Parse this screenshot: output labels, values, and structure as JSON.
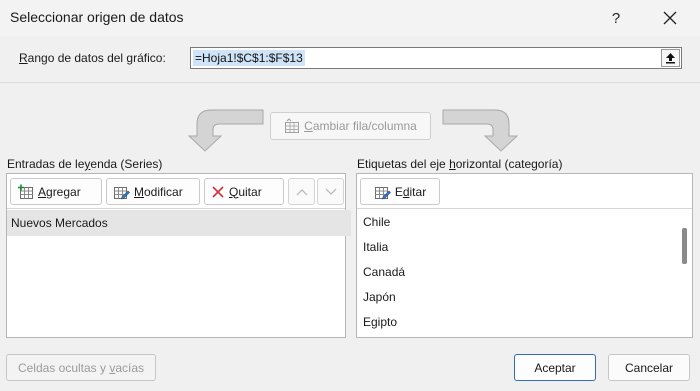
{
  "window": {
    "title": "Seleccionar origen de datos",
    "help_label": "?",
    "close_label": "×"
  },
  "range": {
    "label_prefix": "",
    "label_accel": "R",
    "label_rest": "ango de datos del gráfico:",
    "value": "=Hoja1!$C$1:$F$13"
  },
  "switch_button": {
    "accel": "C",
    "rest": "ambiar fila/columna"
  },
  "legend_group": {
    "label_pre": "Entradas de le",
    "label_accel": "y",
    "label_post": "enda (Series)",
    "add": {
      "accel": "A",
      "rest": "gregar"
    },
    "edit": {
      "accel": "M",
      "rest": "odificar"
    },
    "remove": {
      "accel": "Q",
      "rest": "uitar"
    },
    "series": [
      "Nuevos Mercados"
    ]
  },
  "axis_group": {
    "label_pre": "Etiquetas del eje ",
    "label_accel": "h",
    "label_post": "orizontal (categoría)",
    "edit": {
      "pre": "E",
      "accel": "d",
      "rest": "itar"
    },
    "categories": [
      "Chile",
      "Italia",
      "Canadá",
      "Japón",
      "Egipto"
    ]
  },
  "buttons": {
    "hidden_pre": "Celdas ocultas y ",
    "hidden_accel": "v",
    "hidden_post": "acías",
    "ok": "Aceptar",
    "cancel": "Cancelar"
  },
  "colors": {
    "selection": "#cfe4f8",
    "default_button_border": "#2f6fb8",
    "remove_icon": "#d13438"
  }
}
